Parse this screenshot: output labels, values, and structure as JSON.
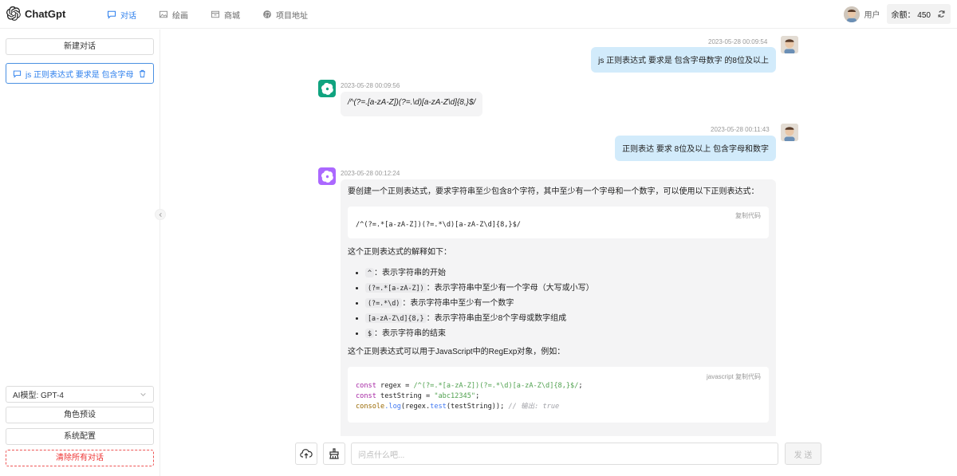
{
  "app": {
    "name": "ChatGpt"
  },
  "nav": [
    {
      "label": "对话",
      "icon": "chat-icon"
    },
    {
      "label": "绘画",
      "icon": "image-icon"
    },
    {
      "label": "商城",
      "icon": "shop-icon"
    },
    {
      "label": "项目地址",
      "icon": "github-icon"
    }
  ],
  "user": {
    "label": "用户",
    "balance": "余额： 450"
  },
  "sidebar": {
    "new_chat": "新建对话",
    "chats": [
      {
        "title": "js 正则表达式 要求是 包含字母..."
      }
    ],
    "model": "AI模型: GPT-4",
    "role_preset": "角色预设",
    "system_config": "系统配置",
    "clear_all": "清除所有对话"
  },
  "messages": [
    {
      "role": "user",
      "time": "2023-05-28 00:09:54",
      "text": "js 正则表达式 要求是 包含字母数字 的8位及以上"
    },
    {
      "role": "bot",
      "time": "2023-05-28 00:09:56",
      "text": "/^(?=.[a-zA-Z])(?=.\\d)[a-zA-Z\\d]{8,}$/"
    },
    {
      "role": "user",
      "time": "2023-05-28 00:11:43",
      "text": "正则表达 要求 8位及以上 包含字母和数字"
    },
    {
      "role": "bot",
      "time": "2023-05-28 00:12:24",
      "intro": "要创建一个正则表达式，要求字符串至少包含8个字符，其中至少有一个字母和一个数字，可以使用以下正则表达式：",
      "code1_hint": "复制代码",
      "code1": "/^(?=.*[a-zA-Z])(?=.*\\d)[a-zA-Z\\d]{8,}$/",
      "explain_title": "这个正则表达式的解释如下：",
      "bullets": [
        {
          "code": "^",
          "text": "：表示字符串的开始"
        },
        {
          "code": "(?=.*[a-zA-Z])",
          "text": "：表示字符串中至少有一个字母（大写或小写）"
        },
        {
          "code": "(?=.*\\d)",
          "text": "：表示字符串中至少有一个数字"
        },
        {
          "code": "[a-zA-Z\\d]{8,}",
          "text": "：表示字符串由至少8个字母或数字组成"
        },
        {
          "code": "$",
          "text": "：表示字符串的结束"
        }
      ],
      "usage": "这个正则表达式可以用于JavaScript中的RegExp对象，例如：",
      "code2_lang": "javascript",
      "code2_hint": "复制代码",
      "code2": {
        "line1_kw": "const",
        "line1_name": " regex = ",
        "line1_regex": "/^(?=.*[a-zA-Z])(?=.*\\d)[a-zA-Z\\d]{8,}$/",
        "line1_end": ";",
        "line2_kw": "const",
        "line2_name": " testString = ",
        "line2_str": "\"abc12345\"",
        "line2_end": ";",
        "line3_obj": "console",
        "line3_fn": ".log",
        "line3_mid": "(regex.",
        "line3_fn2": "test",
        "line3_end": "(testString)); ",
        "line3_comment": "// 输出: true"
      }
    }
  ],
  "input": {
    "placeholder": "问点什么吧...",
    "send": "发 送"
  },
  "colors": {
    "accent": "#2f80ed",
    "user_bubble": "#d2ebfb",
    "bot_bubble": "#f4f4f5",
    "bot1_icon": "#10a37f",
    "bot2_icon": "#ab68ff",
    "danger": "#e33"
  }
}
